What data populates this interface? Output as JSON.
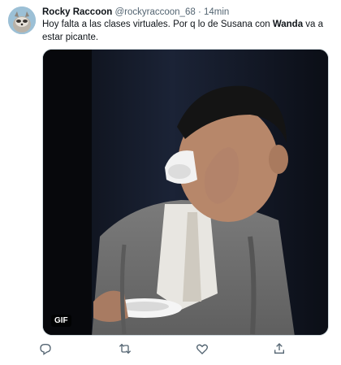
{
  "tweet": {
    "author_name": "Rocky Raccoon",
    "handle": "@rockyraccoon_68",
    "separator": "·",
    "time": "14min",
    "text_part1": "Hoy falta a las clases virtuales. Por q lo de Susana con ",
    "text_bold": "Wanda",
    "text_part2": " va a estar picante.",
    "media_badge": "GIF"
  },
  "actions": [
    {
      "name": "reply",
      "icon": "reply-icon"
    },
    {
      "name": "retweet",
      "icon": "retweet-icon"
    },
    {
      "name": "like",
      "icon": "heart-icon"
    },
    {
      "name": "share",
      "icon": "share-icon"
    }
  ],
  "colors": {
    "text_primary": "#0f1419",
    "text_secondary": "#536471",
    "border": "#cfd9de"
  }
}
